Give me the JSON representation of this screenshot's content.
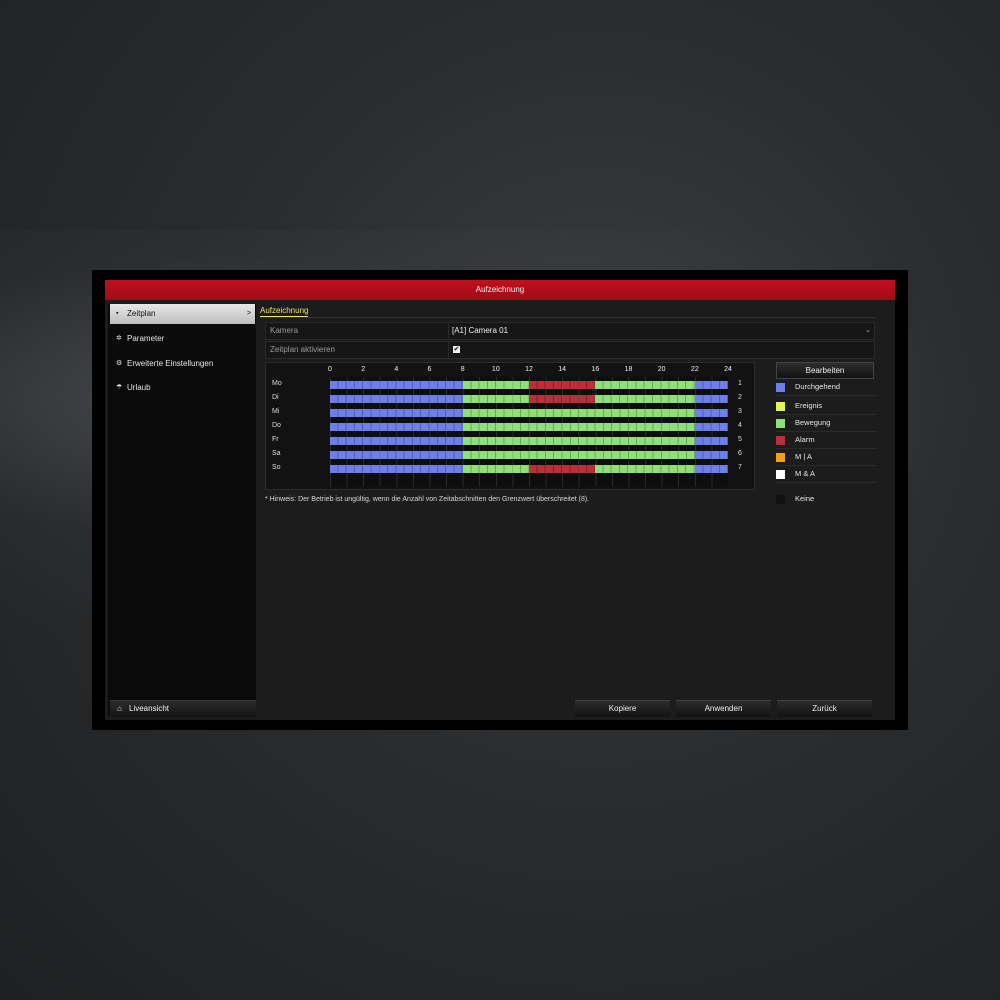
{
  "window": {
    "title": "Aufzeichnung"
  },
  "sidebar": {
    "items": [
      {
        "label": "Zeitplan",
        "icon": "square-icon",
        "glyph": "▪",
        "active": true,
        "chevron": ">"
      },
      {
        "label": "Parameter",
        "icon": "gear-icon",
        "glyph": "✲",
        "active": false
      },
      {
        "label": "Erweiterte Einstellungen",
        "icon": "advanced-settings-icon",
        "glyph": "⚙",
        "active": false
      },
      {
        "label": "Urlaub",
        "icon": "vacation-icon",
        "glyph": "☂",
        "active": false
      }
    ],
    "live_view": {
      "label": "Liveansicht",
      "icon": "home-icon",
      "glyph": "⌂"
    }
  },
  "tabs": [
    {
      "label": "Aufzeichnung",
      "active": true
    }
  ],
  "form": {
    "camera_label": "Kamera",
    "camera_value": "[A1] Camera 01",
    "camera_caret": "⌄",
    "enable_label": "Zeitplan aktivieren",
    "enable_checked": true,
    "check_glyph": "✔"
  },
  "schedule": {
    "hour_labels": [
      "0",
      "2",
      "4",
      "6",
      "8",
      "10",
      "12",
      "14",
      "16",
      "18",
      "20",
      "22",
      "24"
    ],
    "days": [
      {
        "label": "Mo",
        "num": "1",
        "segments": [
          {
            "start": 0,
            "end": 8,
            "mode": "blue"
          },
          {
            "start": 8,
            "end": 12,
            "mode": "green"
          },
          {
            "start": 12,
            "end": 16,
            "mode": "red"
          },
          {
            "start": 16,
            "end": 22,
            "mode": "green"
          },
          {
            "start": 22,
            "end": 24,
            "mode": "blue"
          }
        ]
      },
      {
        "label": "Di",
        "num": "2",
        "segments": [
          {
            "start": 0,
            "end": 8,
            "mode": "blue"
          },
          {
            "start": 8,
            "end": 12,
            "mode": "green"
          },
          {
            "start": 12,
            "end": 16,
            "mode": "red"
          },
          {
            "start": 16,
            "end": 22,
            "mode": "green"
          },
          {
            "start": 22,
            "end": 24,
            "mode": "blue"
          }
        ]
      },
      {
        "label": "Mi",
        "num": "3",
        "segments": [
          {
            "start": 0,
            "end": 8,
            "mode": "blue"
          },
          {
            "start": 8,
            "end": 22,
            "mode": "green"
          },
          {
            "start": 22,
            "end": 24,
            "mode": "blue"
          }
        ]
      },
      {
        "label": "Do",
        "num": "4",
        "segments": [
          {
            "start": 0,
            "end": 8,
            "mode": "blue"
          },
          {
            "start": 8,
            "end": 22,
            "mode": "green"
          },
          {
            "start": 22,
            "end": 24,
            "mode": "blue"
          }
        ]
      },
      {
        "label": "Fr",
        "num": "5",
        "segments": [
          {
            "start": 0,
            "end": 8,
            "mode": "blue"
          },
          {
            "start": 8,
            "end": 22,
            "mode": "green"
          },
          {
            "start": 22,
            "end": 24,
            "mode": "blue"
          }
        ]
      },
      {
        "label": "Sa",
        "num": "6",
        "segments": [
          {
            "start": 0,
            "end": 8,
            "mode": "blue"
          },
          {
            "start": 8,
            "end": 22,
            "mode": "green"
          },
          {
            "start": 22,
            "end": 24,
            "mode": "blue"
          }
        ]
      },
      {
        "label": "So",
        "num": "7",
        "segments": [
          {
            "start": 0,
            "end": 8,
            "mode": "blue"
          },
          {
            "start": 8,
            "end": 12,
            "mode": "green"
          },
          {
            "start": 12,
            "end": 16,
            "mode": "red"
          },
          {
            "start": 16,
            "end": 22,
            "mode": "green"
          },
          {
            "start": 22,
            "end": 24,
            "mode": "blue"
          }
        ]
      }
    ]
  },
  "edit_button": {
    "label": "Bearbeiten"
  },
  "legend": [
    {
      "label": "Durchgehend",
      "color": "#6f7fe8"
    },
    {
      "label": "Ereignis",
      "color": "#e4f55a"
    },
    {
      "label": "Bewegung",
      "color": "#8fe07a"
    },
    {
      "label": "Alarm",
      "color": "#b8303a"
    },
    {
      "label": "M | A",
      "color": "#f0a020"
    },
    {
      "label": "M & A",
      "color": "#ffffff"
    },
    {
      "label": "Keine",
      "color": "#111111"
    }
  ],
  "hint": "* Hinweis: Der Betrieb ist ungültig, wenn die Anzahl von Zeitabschnitten den Grenzwert überschreitet (8).",
  "buttons": {
    "copy": "Kopiere",
    "apply": "Anwenden",
    "back": "Zurück"
  }
}
